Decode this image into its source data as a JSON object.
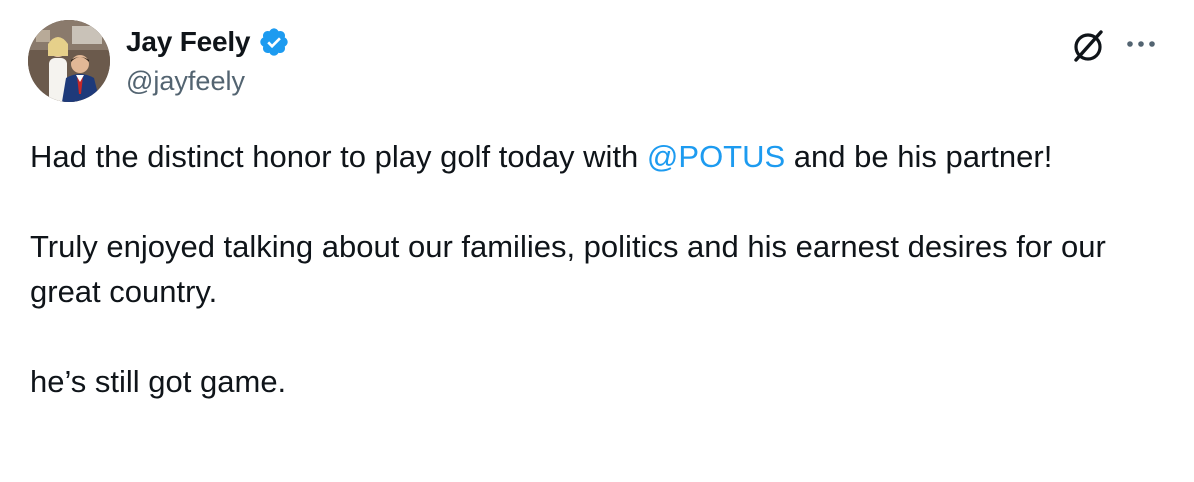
{
  "author": {
    "display_name": "Jay Feely",
    "handle": "@jayfeely",
    "verified": true,
    "avatar_icon": "profile-photo"
  },
  "actions": {
    "grok_icon": "grok-icon",
    "more_icon": "more-options-icon"
  },
  "tweet": {
    "line1_before": "Had the distinct honor to play golf today with ",
    "mention": "@POTUS",
    "line1_after": " and be his partner!",
    "paragraph2": "Truly enjoyed talking about our families, politics and his earnest desires for our great country.",
    "paragraph3": "he’s still got game."
  },
  "colors": {
    "text": "#0f1419",
    "secondary": "#536471",
    "link": "#1d9bf0",
    "verified": "#1d9bf0"
  }
}
